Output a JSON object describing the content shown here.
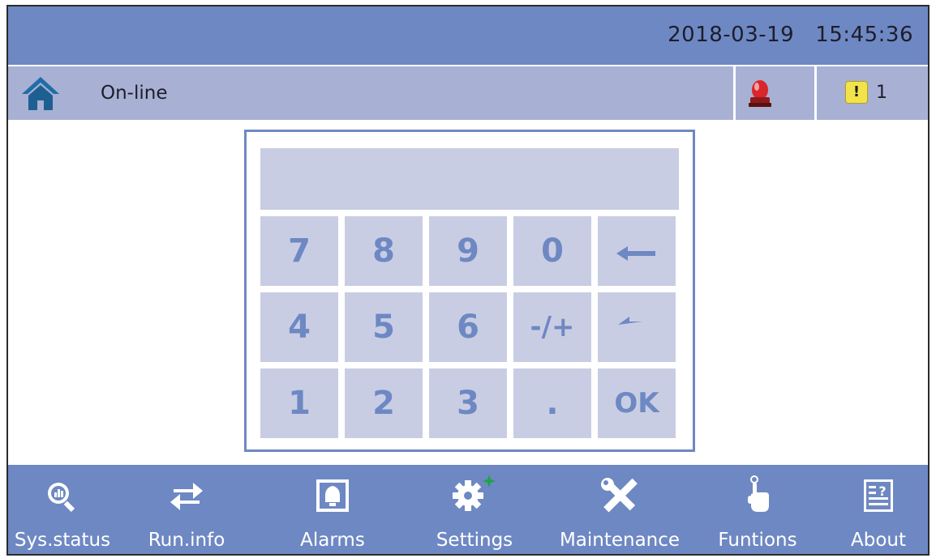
{
  "header": {
    "date": "2018-03-19",
    "time": "15:45:36"
  },
  "status": {
    "text": "On-line",
    "warning_symbol": "!",
    "warning_count": "1"
  },
  "keypad": {
    "display_value": "",
    "keys": {
      "k7": "7",
      "k8": "8",
      "k9": "9",
      "k0": "0",
      "backspace": "←",
      "k4": "4",
      "k5": "5",
      "k6": "6",
      "sign": "-/+",
      "return": "↩",
      "k1": "1",
      "k2": "2",
      "k3": "3",
      "dot": ".",
      "ok": "OK"
    }
  },
  "nav": {
    "sys_status": "Sys.status",
    "run_info": "Run.info",
    "alarms": "Alarms",
    "settings": "Settings",
    "maintenance": "Maintenance",
    "functions": "Funtions",
    "about": "About"
  },
  "colors": {
    "accent": "#6e88c3",
    "status_bar": "#a8b0d4",
    "key_bg": "#c9cde3",
    "alarm_red": "#d9262a",
    "warn_yellow": "#f2e34a",
    "settings_plus": "#1fa34a"
  },
  "icons": [
    "home-icon",
    "alarm-light-icon",
    "warning-icon",
    "sys-status-icon",
    "run-info-icon",
    "alarms-icon",
    "settings-icon",
    "maintenance-icon",
    "functions-icon",
    "about-icon",
    "backspace-icon",
    "return-icon"
  ]
}
